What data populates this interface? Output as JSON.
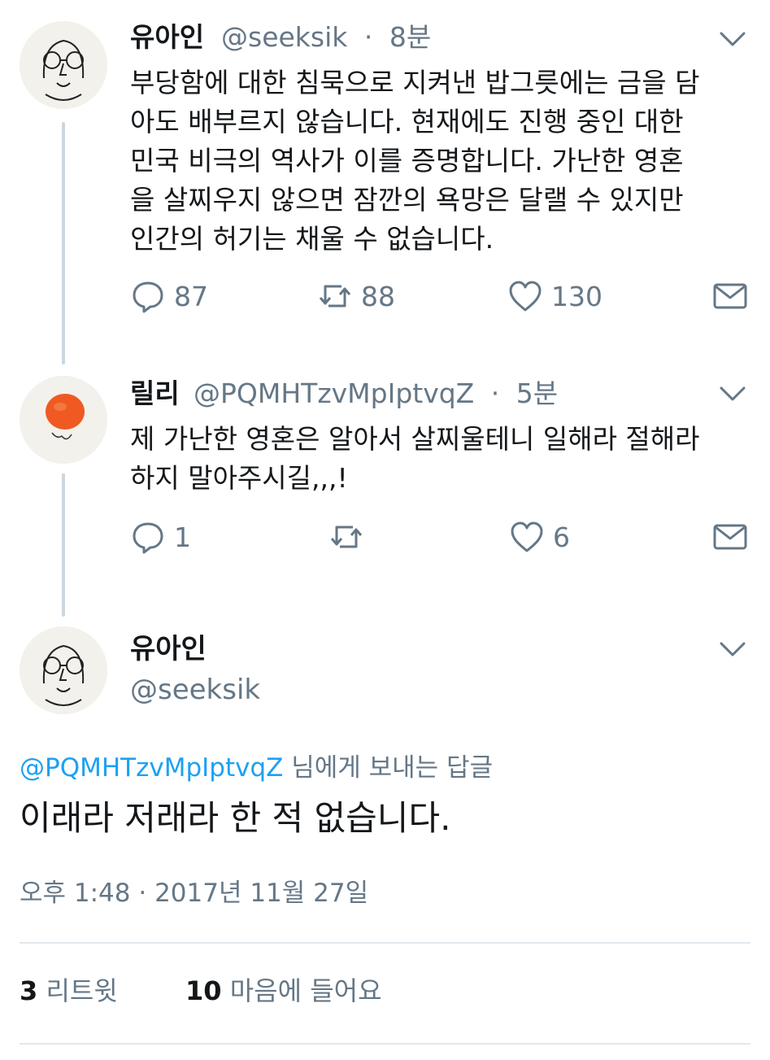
{
  "tweets": [
    {
      "name": "유아인",
      "handle": "@seeksik",
      "separator": "·",
      "time": "8분",
      "lines": [
        "부당함에 대한 침묵으로 지켜낸 밥그릇에는 금을 담",
        "아도 배부르지 않습니다. 현재에도 진행 중인 대한",
        "민국 비극의 역사가 이를 증명합니다. 가난한 영혼",
        "을 살찌우지 않으면 잠깐의 욕망은 달랠 수 있지만",
        "인간의 허기는 채울 수 없습니다."
      ],
      "replies": "87",
      "retweets": "88",
      "likes": "130"
    },
    {
      "name": "릴리",
      "handle": "@PQMHTzvMpIptvqZ",
      "separator": "·",
      "time": "5분",
      "lines": [
        "제 가난한 영혼은 알아서 살찌울테니 일해라 절해라",
        "하지 말아주시길,,,!"
      ],
      "replies": "1",
      "retweets": "",
      "likes": "6"
    }
  ],
  "main_tweet": {
    "name": "유아인",
    "handle": "@seeksik",
    "reply_to_handle": "@PQMHTzvMpIptvqZ",
    "reply_to_suffix": " 님에게 보내는 답글",
    "text": "이래라 저래라 한 적 없습니다.",
    "timestamp": "오후 1:48 · 2017년 11월 27일",
    "retweet_count": "3",
    "retweet_label": " 리트윗",
    "like_count": "10",
    "like_label": " 마음에 들어요"
  },
  "icons": [
    "reply-icon",
    "retweet-icon",
    "like-icon",
    "message-icon",
    "chevron-down-icon"
  ],
  "colors": {
    "link": "#1da1f2",
    "muted": "#657786",
    "text": "#14171a",
    "thread_line": "#ccd6dd"
  }
}
